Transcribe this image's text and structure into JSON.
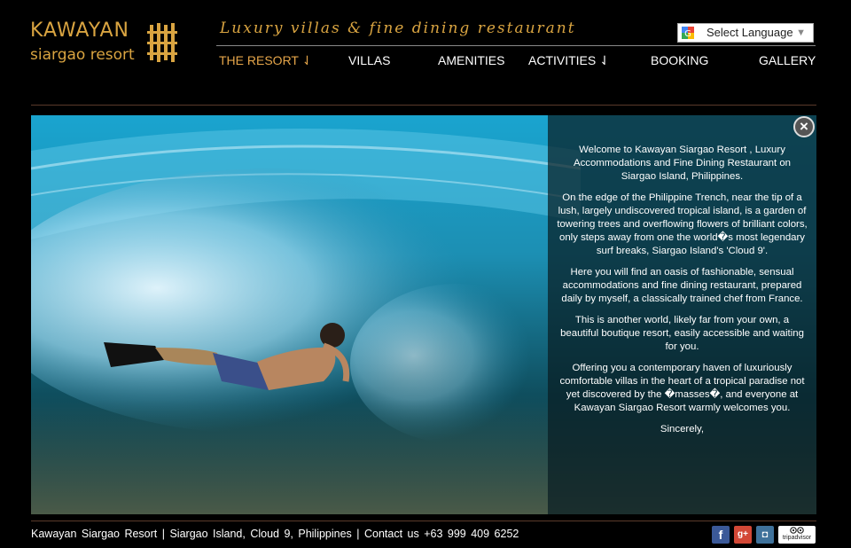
{
  "brand": {
    "name": "KAWAYAN",
    "subtitle": "siargao resort"
  },
  "tagline": "Luxury villas & fine dining restaurant",
  "language": {
    "label": "Select Language",
    "arrow": "▼"
  },
  "nav": [
    {
      "label": "THE RESORT ⇃",
      "active": true
    },
    {
      "label": "VILLAS"
    },
    {
      "label": "AMENITIES"
    },
    {
      "label": "ACTIVITIES ⇃"
    },
    {
      "label": "BOOKING"
    },
    {
      "label": "GALLERY"
    }
  ],
  "hero": {
    "close": "×",
    "paragraphs": [
      "Welcome to Kawayan Siargao Resort , Luxury Accommodations and Fine Dining Restaurant on Siargao Island, Philippines.",
      "On the edge of the Philippine Trench, near the tip of a lush, largely undiscovered tropical island, is a garden of towering trees and overflowing flowers of brilliant colors, only steps away from one the world�s most legendary surf breaks, Siargao Island's 'Cloud 9'.",
      "Here you will find an oasis of fashionable, sensual accommodations and fine dining restaurant, prepared daily by myself, a classically trained chef from France.",
      "This is another world, likely far from your own, a beautiful boutique resort, easily accessible and waiting for you.",
      "Offering you a contemporary haven of luxuriously comfortable villas in the heart of a tropical paradise not yet discovered by the �masses�, and everyone at Kawayan Siargao Resort warmly welcomes you.",
      "Sincerely,"
    ]
  },
  "footer": {
    "text": "Kawayan Siargao Resort | Siargao Island, Cloud 9, Philippines | Contact us +63 999 409 6252",
    "social": {
      "facebook": "f",
      "googleplus": "g+",
      "instagram": "◘",
      "tripadvisor": "tripadvisor"
    }
  },
  "colors": {
    "accent": "#d9a441",
    "active_nav": "#e6a64a",
    "background": "#000000"
  }
}
